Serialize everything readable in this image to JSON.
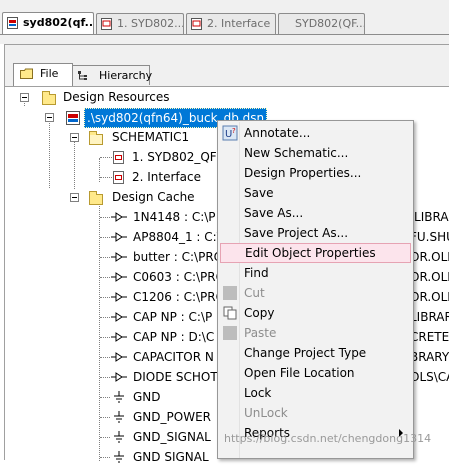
{
  "doc_tabs": [
    {
      "label": "syd802(qf...",
      "active": true
    },
    {
      "label": "1. SYD802...",
      "active": false
    },
    {
      "label": "2. Interface",
      "active": false
    },
    {
      "label": "SYD802(QF...",
      "active": false
    }
  ],
  "panel_tabs": [
    {
      "label": "File",
      "icon": "folder-icon",
      "active": true
    },
    {
      "label": "Hierarchy",
      "icon": "hierarchy-icon",
      "active": false
    }
  ],
  "tree": {
    "root": "Design Resources",
    "design_file": ".\\syd802(qfn64)_buck_db.dsn",
    "schematic": "SCHEMATIC1",
    "pages": [
      "1. SYD802_QF",
      "2. Interface"
    ],
    "cache": "Design Cache",
    "cache_items": [
      {
        "name": "1N4148 : C:\\P",
        "right": "\\LIBRA"
      },
      {
        "name": "AP8804_1 : C:\\",
        "right": "FU.SHU"
      },
      {
        "name": "butter : C:\\PRO",
        "right": "OR.OLE"
      },
      {
        "name": "C0603 : C:\\PRO",
        "right": "OR.OLE"
      },
      {
        "name": "C1206 : C:\\PRO",
        "right": "OR.OLE"
      },
      {
        "name": "CAP NP : C:\\P",
        "right": "LIBRARY"
      },
      {
        "name": "CAP NP : D:\\C",
        "right": "CRETE.O"
      },
      {
        "name": "CAPACITOR N",
        "right": "BRARY\\"
      },
      {
        "name": "DIODE SCHOT",
        "right": "OLS\\CA"
      },
      {
        "name": "GND",
        "right": ""
      },
      {
        "name": "GND_POWER",
        "right": ""
      },
      {
        "name": "GND_SIGNAL",
        "right": ""
      },
      {
        "name": "GND SIGNAL",
        "right": ""
      }
    ]
  },
  "context_menu": {
    "items": [
      {
        "label": "Annotate...",
        "icon": "annotate-icon",
        "disabled": false
      },
      {
        "label": "New Schematic...",
        "icon": "",
        "disabled": false
      },
      {
        "label": "Design Properties...",
        "icon": "",
        "disabled": false
      },
      {
        "label": "Save",
        "icon": "",
        "disabled": false
      },
      {
        "label": "Save As...",
        "icon": "",
        "disabled": false
      },
      {
        "label": "Save Project As...",
        "icon": "",
        "disabled": false
      },
      {
        "label": "Edit Object Properties",
        "icon": "",
        "disabled": false,
        "highlighted": true
      },
      {
        "label": "Find",
        "icon": "",
        "disabled": false
      },
      {
        "label": "Cut",
        "icon": "cut-icon",
        "disabled": true
      },
      {
        "label": "Copy",
        "icon": "copy-icon",
        "disabled": false
      },
      {
        "label": "Paste",
        "icon": "paste-icon",
        "disabled": true
      },
      {
        "label": "Change Project Type",
        "icon": "",
        "disabled": false
      },
      {
        "label": "Open File Location",
        "icon": "",
        "disabled": false
      },
      {
        "label": "Lock",
        "icon": "",
        "disabled": false
      },
      {
        "label": "UnLock",
        "icon": "",
        "disabled": true
      },
      {
        "label": "Reports",
        "icon": "",
        "disabled": false,
        "submenu": true
      }
    ]
  },
  "watermark": "https://blog.csdn.net/chengdong1314",
  "colors": {
    "selection": "#0078d7",
    "highlight_bg": "#fce4ec",
    "folder": "#ffe98a"
  }
}
